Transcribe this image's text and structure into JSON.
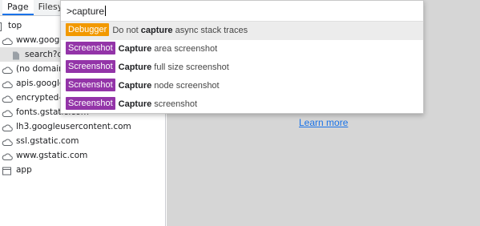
{
  "tabs": [
    {
      "label": "Page",
      "active": true
    },
    {
      "label": "Filesy",
      "active": false
    }
  ],
  "tree": [
    {
      "label": "top",
      "icon": "frame-icon",
      "indent": 0
    },
    {
      "label": "www.googl",
      "icon": "cloud-icon",
      "indent": 1
    },
    {
      "label": "search?q",
      "icon": "file-icon",
      "indent": 2,
      "selected": true
    },
    {
      "label": "(no domain",
      "icon": "cloud-icon",
      "indent": 1
    },
    {
      "label": "apis.google",
      "icon": "cloud-icon",
      "indent": 1
    },
    {
      "label": "encrypted-t",
      "icon": "cloud-icon",
      "indent": 1
    },
    {
      "label": "fonts.gstatic.com",
      "icon": "cloud-icon",
      "indent": 1
    },
    {
      "label": "lh3.googleusercontent.com",
      "icon": "cloud-icon",
      "indent": 1
    },
    {
      "label": "ssl.gstatic.com",
      "icon": "cloud-icon",
      "indent": 1
    },
    {
      "label": "www.gstatic.com",
      "icon": "cloud-icon",
      "indent": 1
    },
    {
      "label": "app",
      "icon": "window-icon",
      "indent": 1
    }
  ],
  "palette": {
    "query": ">capture",
    "commands": [
      {
        "category": "Debugger",
        "pre": "Do not ",
        "match": "capture",
        "post": " async stack traces",
        "highlighted": true
      },
      {
        "category": "Screenshot",
        "pre": "",
        "match": "Capture",
        "post": " area screenshot"
      },
      {
        "category": "Screenshot",
        "pre": "",
        "match": "Capture",
        "post": " full size screenshot"
      },
      {
        "category": "Screenshot",
        "pre": "",
        "match": "Capture",
        "post": " node screenshot"
      },
      {
        "category": "Screenshot",
        "pre": "",
        "match": "Capture",
        "post": " screenshot"
      }
    ]
  },
  "right_pane": {
    "learn_more": "Learn more"
  },
  "colors": {
    "debugger_badge": "#f29900",
    "screenshot_badge": "#9334a8",
    "link": "#1a73e8"
  }
}
